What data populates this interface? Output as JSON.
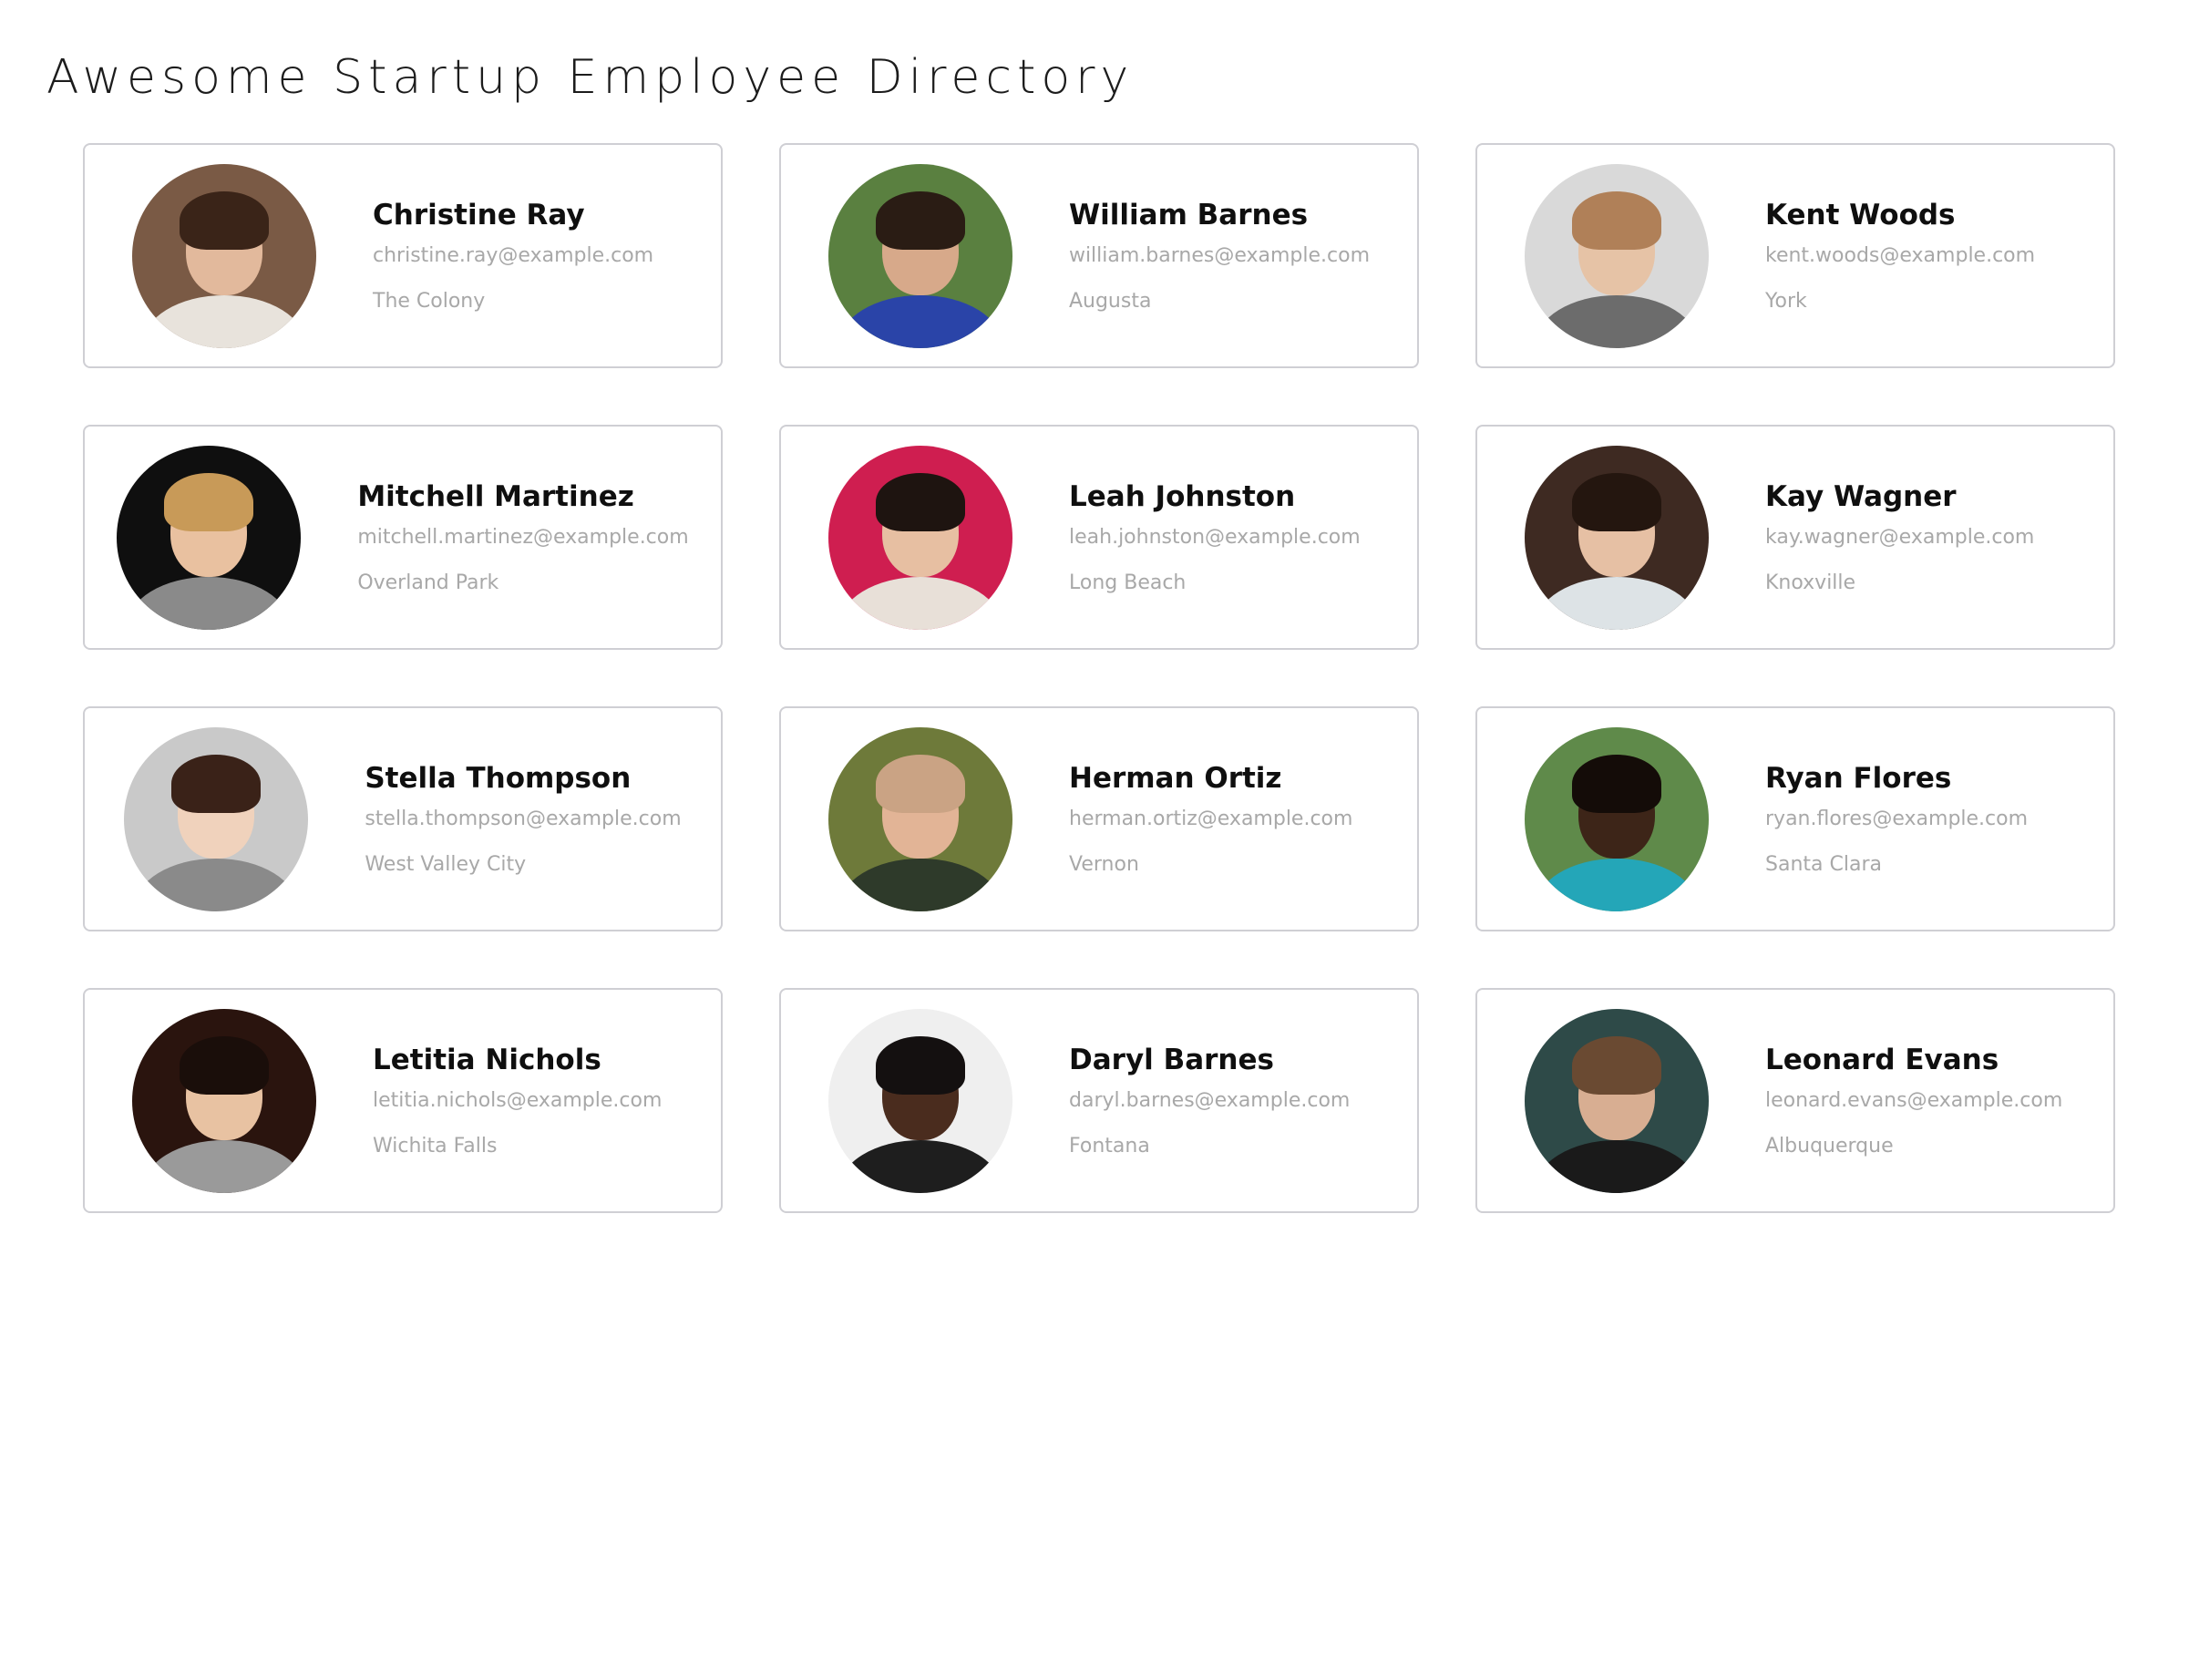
{
  "page": {
    "title": "Awesome Startup Employee Directory"
  },
  "employees": [
    {
      "name": "Christine Ray",
      "email": "christine.ray@example.com",
      "city": "The Colony",
      "bg": "#7a5a45",
      "skin": "#e2b99c",
      "hair": "#3a2418",
      "shirt": "#e8e3dc"
    },
    {
      "name": "William Barnes",
      "email": "william.barnes@example.com",
      "city": "Augusta",
      "bg": "#5a8040",
      "skin": "#d7a98a",
      "hair": "#2a1c14",
      "shirt": "#2a44a8"
    },
    {
      "name": "Kent Woods",
      "email": "kent.woods@example.com",
      "city": "York",
      "bg": "#d9d9d9",
      "skin": "#e6c3a6",
      "hair": "#b08058",
      "shirt": "#6c6c6c"
    },
    {
      "name": "Mitchell Martinez",
      "email": "mitchell.martinez@example.com",
      "city": "Overland Park",
      "bg": "#0f0f0f",
      "skin": "#e9c1a0",
      "hair": "#c89a58",
      "shirt": "#8a8a8a"
    },
    {
      "name": "Leah Johnston",
      "email": "leah.johnston@example.com",
      "city": "Long Beach",
      "bg": "#cf1e50",
      "skin": "#e7bfa2",
      "hair": "#1e1410",
      "shirt": "#e8e0d8"
    },
    {
      "name": "Kay Wagner",
      "email": "kay.wagner@example.com",
      "city": "Knoxville",
      "bg": "#3e2a22",
      "skin": "#e6c0a4",
      "hair": "#24160f",
      "shirt": "#dde3e6"
    },
    {
      "name": "Stella Thompson",
      "email": "stella.thompson@example.com",
      "city": "West Valley City",
      "bg": "#c9c9c9",
      "skin": "#f0d2bc",
      "hair": "#3a2218",
      "shirt": "#8a8a8a"
    },
    {
      "name": "Herman Ortiz",
      "email": "herman.ortiz@example.com",
      "city": "Vernon",
      "bg": "#6e7a3a",
      "skin": "#e2b496",
      "hair": "#caa384",
      "shirt": "#2e3a2a"
    },
    {
      "name": "Ryan Flores",
      "email": "ryan.flores@example.com",
      "city": "Santa Clara",
      "bg": "#5f8a4a",
      "skin": "#3d2518",
      "hair": "#140c08",
      "shirt": "#24a6b8"
    },
    {
      "name": "Letitia Nichols",
      "email": "letitia.nichols@example.com",
      "city": "Wichita Falls",
      "bg": "#2a140e",
      "skin": "#e8c2a2",
      "hair": "#1a0e0a",
      "shirt": "#9a9a9a"
    },
    {
      "name": "Daryl Barnes",
      "email": "daryl.barnes@example.com",
      "city": "Fontana",
      "bg": "#efefef",
      "skin": "#4a2c1e",
      "hair": "#141010",
      "shirt": "#1e1e1e"
    },
    {
      "name": "Leonard Evans",
      "email": "leonard.evans@example.com",
      "city": "Albuquerque",
      "bg": "#2e4a48",
      "skin": "#d8ae92",
      "hair": "#6a4a32",
      "shirt": "#1a1a1a"
    }
  ]
}
